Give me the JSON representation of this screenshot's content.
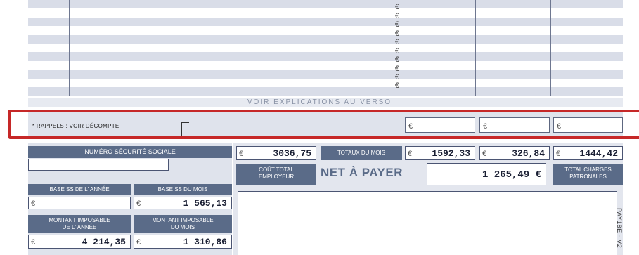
{
  "top_table": {
    "currency_symbol": "€",
    "row_count": 10
  },
  "verso_text": "VOIR EXPLICATIONS AU VERSO",
  "rappels": {
    "label": "* RAPPELS : VOIR DÉCOMPTE",
    "box1": "€",
    "box2": "€",
    "box3": "€"
  },
  "left_panel": {
    "numero_ss_label": "NUMÉRO SÉCURITÉ SOCIALE",
    "numero_ss_value": "",
    "base_ss_annee_label": "BASE SS DE L' ANNÉE",
    "base_ss_mois_label": "BASE SS DU MOIS",
    "base_ss_annee_value": "",
    "base_ss_mois_value": "1 565,13",
    "montant_imposable_annee_label_1": "MONTANT IMPOSABLE",
    "montant_imposable_annee_label_2": "DE L' ANNÉE",
    "montant_imposable_mois_label_1": "MONTANT IMPOSABLE",
    "montant_imposable_mois_label_2": "DU MOIS",
    "montant_imposable_annee_value": "4 214,35",
    "montant_imposable_mois_value": "1 310,86",
    "currency": "€"
  },
  "right_panel": {
    "cout_total_value": "3036,75",
    "totaux_label": "TOTAUX DU MOIS",
    "totaux_value_1": "1592,33",
    "totaux_value_2": "326,84",
    "totaux_value_3": "1444,42",
    "cout_total_label_1": "COÛT TOTAL",
    "cout_total_label_2": "EMPLOYEUR",
    "net_label": "NET À PAYER",
    "net_value": "1 265,49 €",
    "charges_label_1": "TOTAL CHARGES",
    "charges_label_2": "PATRONALES",
    "currency": "€",
    "pay_code": "PAY18E - V2"
  },
  "colors": {
    "stripe": "#d9dde8",
    "dark_header": "#5a6b88",
    "highlight": "#c62828"
  }
}
